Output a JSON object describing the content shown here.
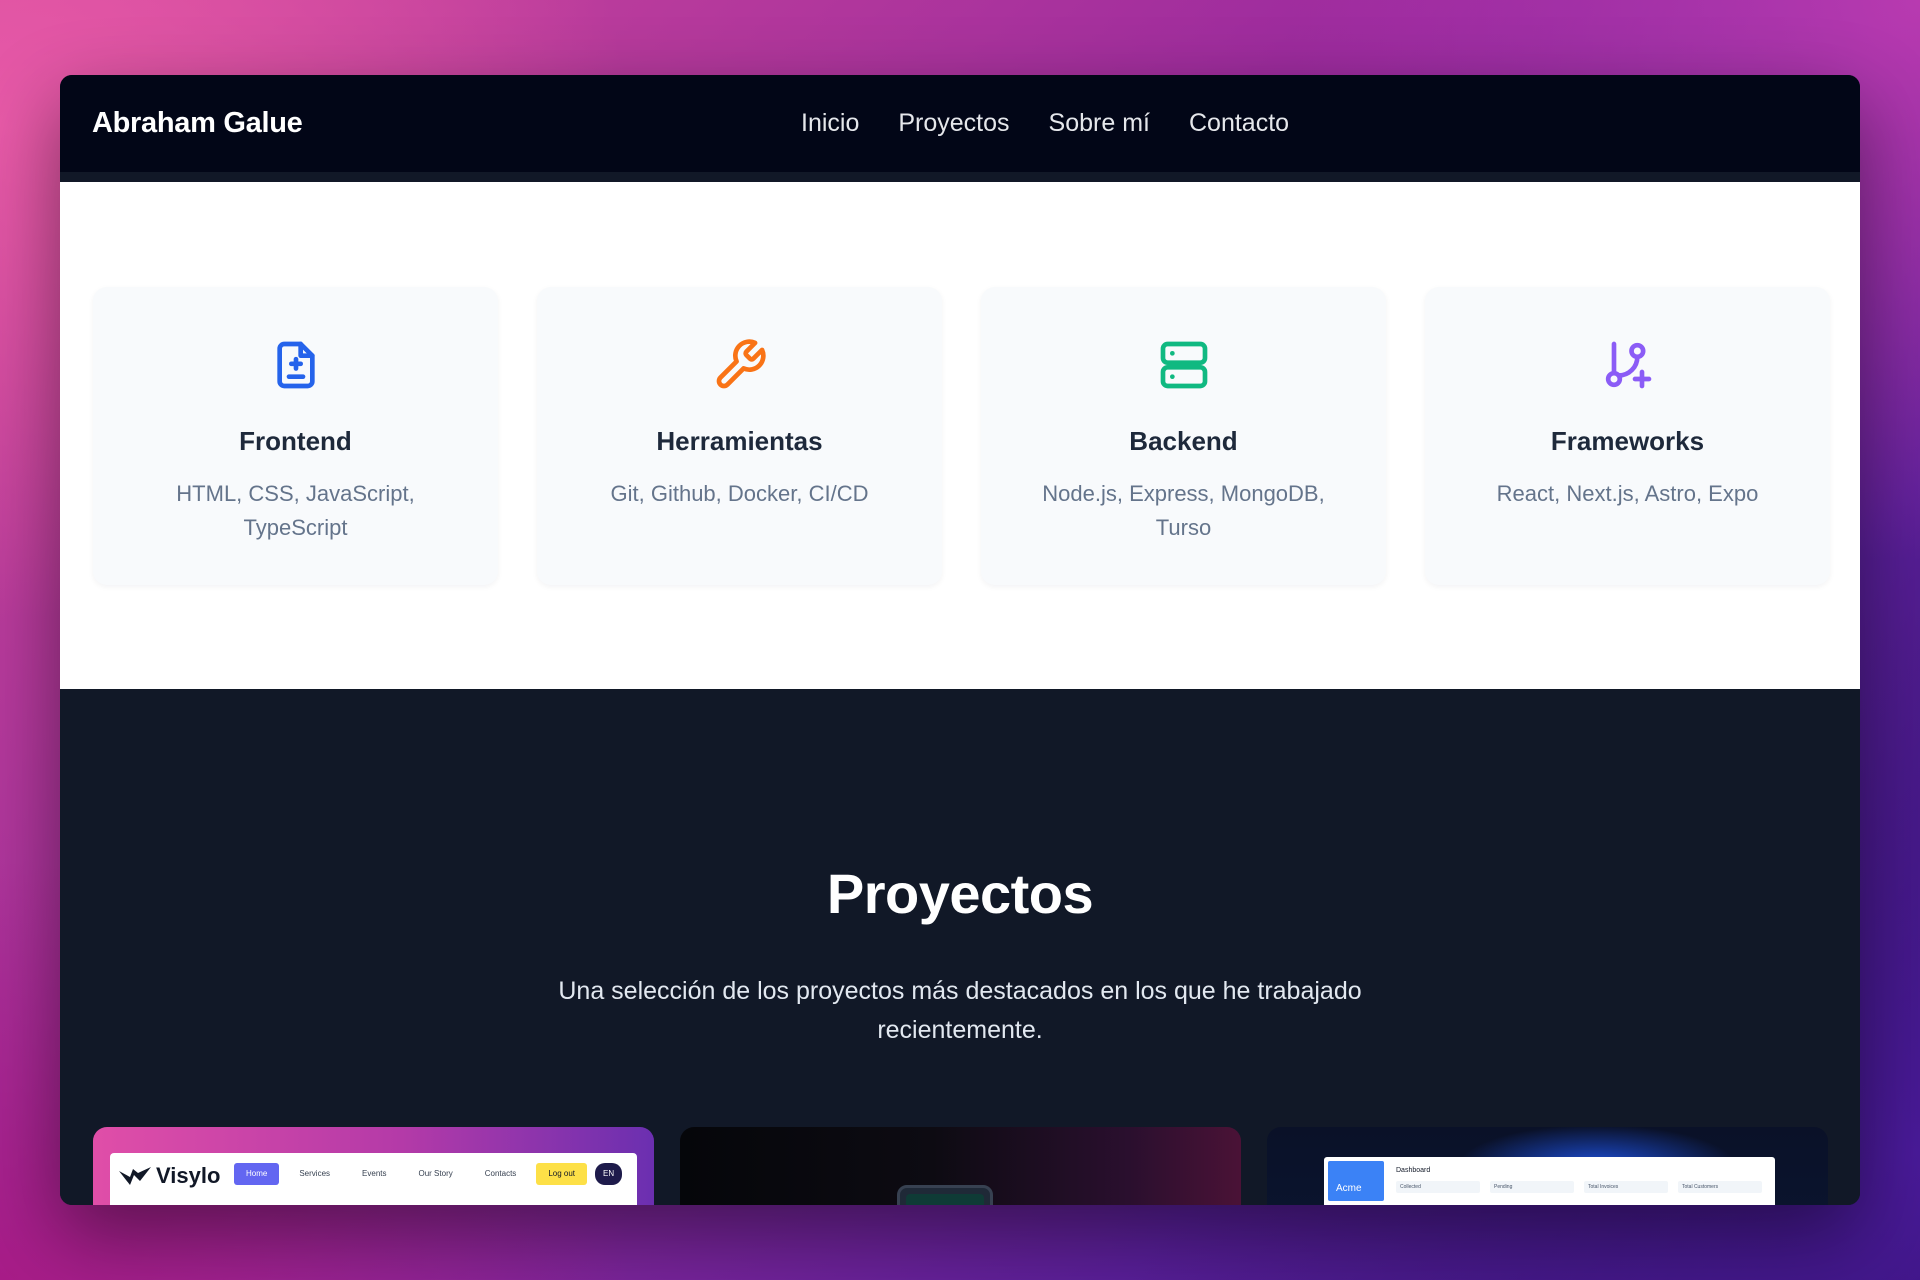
{
  "site": {
    "brand": "Abraham Galue"
  },
  "nav": {
    "items": [
      "Inicio",
      "Proyectos",
      "Sobre mí",
      "Contacto"
    ]
  },
  "skills": {
    "cards": [
      {
        "icon": "document-icon",
        "color": "#2563eb",
        "title": "Frontend",
        "description": "HTML, CSS, JavaScript, TypeScript"
      },
      {
        "icon": "wrench-icon",
        "color": "#f97316",
        "title": "Herramientas",
        "description": "Git, Github, Docker, CI/CD"
      },
      {
        "icon": "server-icon",
        "color": "#10b981",
        "title": "Backend",
        "description": "Node.js, Express, MongoDB, Turso"
      },
      {
        "icon": "git-branch-icon",
        "color": "#8b5cf6",
        "title": "Frameworks",
        "description": "React, Next.js, Astro, Expo"
      }
    ]
  },
  "projects": {
    "title": "Proyectos",
    "subtitle": "Una selección de los proyectos más destacados en los que he trabajado recientemente.",
    "thumb1": {
      "logo": "Visylo",
      "menu": [
        "Home",
        "Services",
        "Events",
        "Our Story",
        "Contacts",
        "Log out",
        "EN"
      ]
    },
    "thumb3": {
      "brand": "Acme",
      "title": "Dashboard",
      "cells": [
        "Collected",
        "Pending",
        "Total Invoices",
        "Total Customers"
      ]
    }
  }
}
